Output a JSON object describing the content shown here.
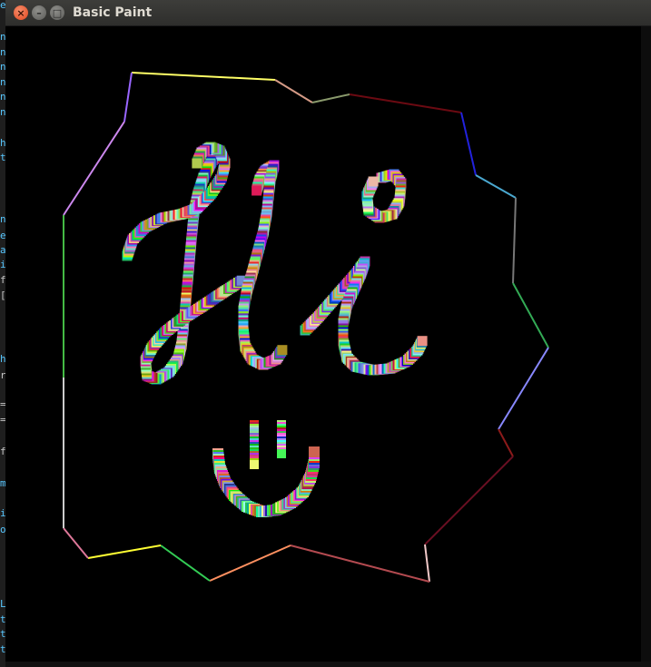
{
  "window": {
    "title": "Basic Paint",
    "close_glyph": "×",
    "minimize_glyph": "–",
    "maximize_glyph": "□"
  },
  "background_editor_chars": [
    "e",
    "n",
    "n",
    "n",
    "n",
    "n",
    "n",
    "h",
    "t",
    "n",
    "e",
    "a",
    "i",
    "f",
    "[",
    "h",
    "r",
    "=",
    "=",
    "f",
    "m",
    "i",
    "o",
    "L",
    "t",
    "t",
    "t"
  ],
  "canvas": {
    "background": "#000000",
    "drawing": {
      "text_strokes": [
        "H",
        "i"
      ],
      "smiley_strokes": [
        "left-eye",
        "right-eye",
        "mouth"
      ],
      "outline_polygon": "multicolor thin line frame"
    }
  },
  "colors": {
    "titlebar": "#3a3a37",
    "close": "#e95420",
    "button_gray": "#6d6d6a",
    "title_text": "#dfdbd2"
  }
}
